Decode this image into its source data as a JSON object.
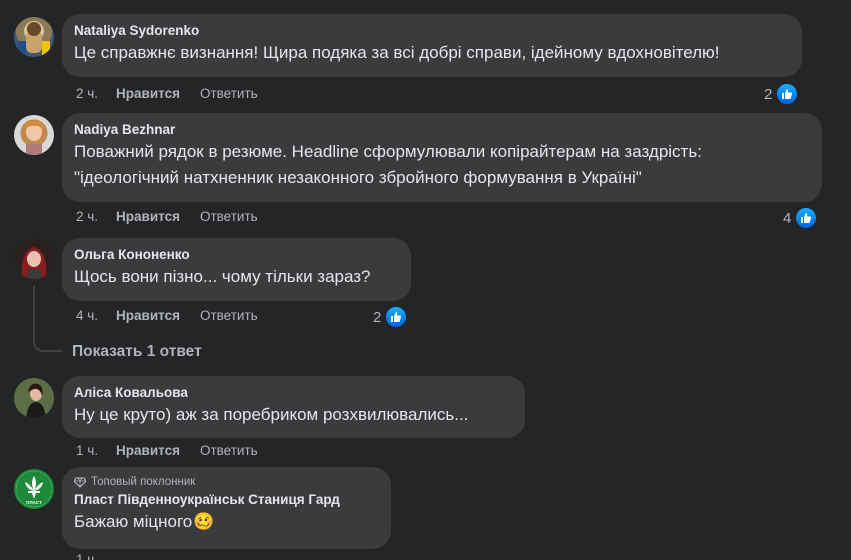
{
  "comments": [
    {
      "author": "Nataliya Sydorenko",
      "text": "Це справжнє визнання! Щира подяка за всі добрі справи, ідейному вдохновітелю!",
      "time": "2 ч.",
      "like_label": "Нравится",
      "reply_label": "Ответить",
      "reactions": "2"
    },
    {
      "author": "Nadiya Bezhnar",
      "text_line1": "Поважний рядок в резюме. Headline сформулювали копірайтерам на заздрість:",
      "text_line2": "\"ідеологічний натхненник незаконного збройного формування в Україні\"",
      "time": "2 ч.",
      "like_label": "Нравится",
      "reply_label": "Ответить",
      "reactions": "4"
    },
    {
      "author": "Ольга Кононенко",
      "text": "Щось вони пізно... чому тільки зараз?",
      "time": "4 ч.",
      "like_label": "Нравится",
      "reply_label": "Ответить",
      "reactions": "2",
      "replies_link": "Показать 1 ответ"
    },
    {
      "author": "Аліса Ковальова",
      "text": "Ну це круто) аж за поребриком розхвилювались...",
      "time": "1 ч.",
      "like_label": "Нравится",
      "reply_label": "Ответить"
    },
    {
      "badge": "Топовый поклонник",
      "author": "Пласт Південноукраїнськ Станиця Гард",
      "text": "Бажаю міцного",
      "emoji": "🥴",
      "avatar_label": "ПЛАСТ"
    }
  ],
  "colors": {
    "background": "#242526",
    "bubble": "#3a3b3c",
    "like_blue": "#1877f2",
    "plast_green": "#1d8a3a"
  }
}
